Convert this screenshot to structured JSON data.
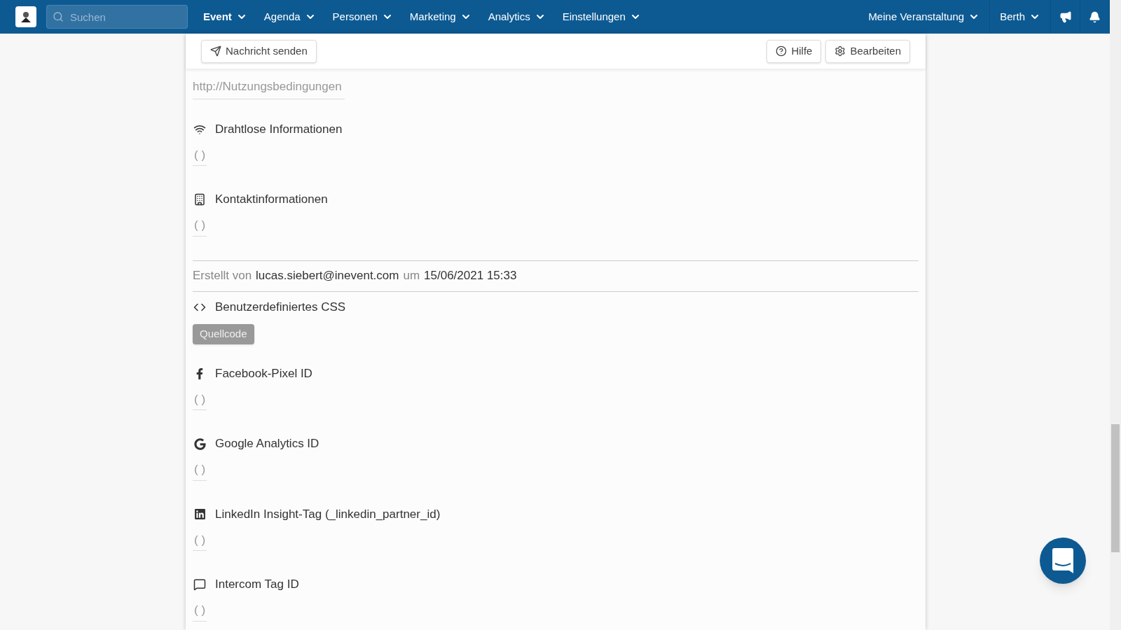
{
  "navbar": {
    "search": {
      "placeholder": "Suchen"
    },
    "menus": [
      {
        "label": "Event",
        "selected": true
      },
      {
        "label": "Agenda",
        "selected": false
      },
      {
        "label": "Personen",
        "selected": false
      },
      {
        "label": "Marketing",
        "selected": false
      },
      {
        "label": "Analytics",
        "selected": false
      },
      {
        "label": "Einstellungen",
        "selected": false
      }
    ],
    "right_menus": [
      {
        "label": "Meine Veranstaltung"
      },
      {
        "label": "Berth"
      }
    ]
  },
  "toolbar": {
    "left_buttons": [
      {
        "label": "Nachricht senden"
      }
    ],
    "right_buttons": [
      {
        "label": "Hilfe"
      },
      {
        "label": "Bearbeiten"
      }
    ]
  },
  "url_value": "http://Nutzungsbedingungen",
  "sections": [
    {
      "kind": "field",
      "title": "Drahtlose Informationen",
      "value": "( )"
    },
    {
      "kind": "field",
      "title": "Kontaktinformationen",
      "value": "( )"
    },
    {
      "kind": "meta",
      "label": "Erstellt von",
      "author": "lucas.siebert@inevent.com",
      "joiner": "um",
      "date": "15/06/2021 15:33"
    },
    {
      "kind": "code",
      "title": "Benutzerdefiniertes CSS",
      "button": "Quellcode"
    },
    {
      "kind": "field",
      "title": "Facebook-Pixel ID",
      "value": "( )"
    },
    {
      "kind": "field",
      "title": "Google Analytics ID",
      "value": "( )"
    },
    {
      "kind": "field",
      "title": "LinkedIn Insight-Tag (_linkedin_partner_id)",
      "value": "( )"
    },
    {
      "kind": "field",
      "title": "Intercom Tag ID",
      "value": "( )"
    }
  ]
}
